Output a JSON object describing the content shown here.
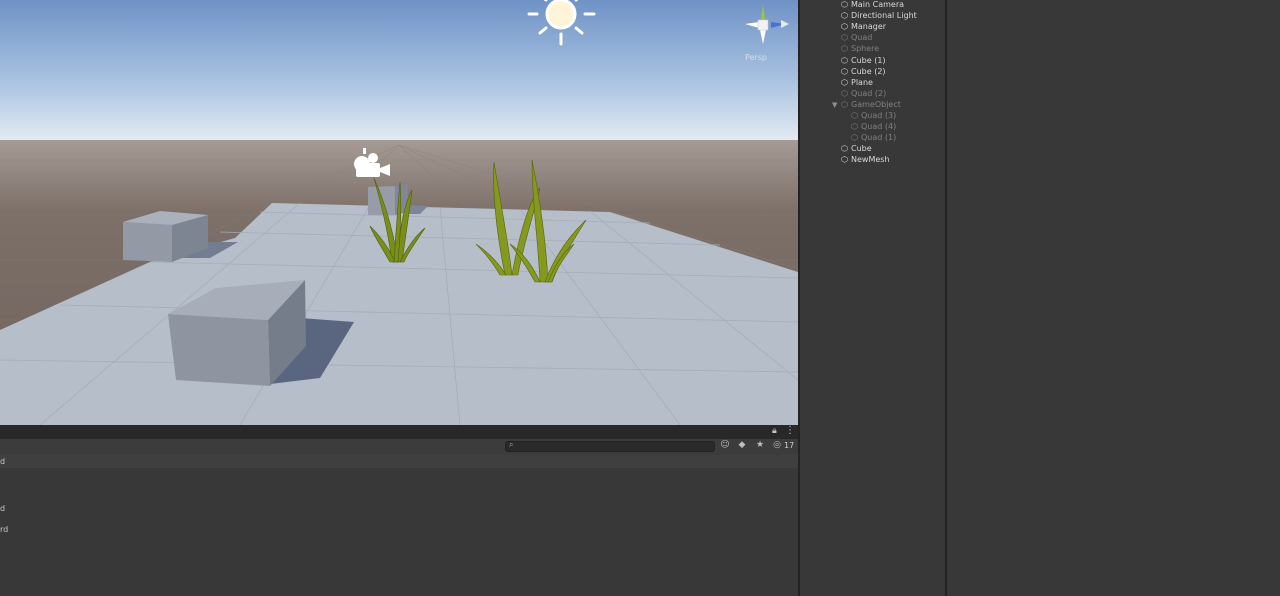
{
  "scene_view": {
    "gizmo_label": "Persp"
  },
  "console": {
    "search": {
      "placeholder": ""
    },
    "message_count": "17",
    "log_fragments": [
      "d",
      "d",
      "rd"
    ]
  },
  "hierarchy": {
    "items": [
      {
        "label": "Main Camera",
        "enabled": true,
        "indent": 0
      },
      {
        "label": "Directional Light",
        "enabled": true,
        "indent": 0
      },
      {
        "label": "Manager",
        "enabled": true,
        "indent": 0
      },
      {
        "label": "Quad",
        "enabled": false,
        "indent": 0
      },
      {
        "label": "Sphere",
        "enabled": false,
        "indent": 0
      },
      {
        "label": "Cube (1)",
        "enabled": true,
        "indent": 0
      },
      {
        "label": "Cube (2)",
        "enabled": true,
        "indent": 0
      },
      {
        "label": "Plane",
        "enabled": true,
        "indent": 0
      },
      {
        "label": "Quad (2)",
        "enabled": false,
        "indent": 0
      },
      {
        "label": "GameObject",
        "enabled": false,
        "indent": 0,
        "expanded": true
      },
      {
        "label": "Quad (3)",
        "enabled": false,
        "indent": 1
      },
      {
        "label": "Quad (4)",
        "enabled": false,
        "indent": 1
      },
      {
        "label": "Quad (1)",
        "enabled": false,
        "indent": 1
      },
      {
        "label": "Cube",
        "enabled": true,
        "indent": 0
      },
      {
        "label": "NewMesh",
        "enabled": true,
        "indent": 0
      }
    ]
  },
  "colors": {
    "sky_top": "#6f92c6",
    "horizon": "#e6eef5",
    "ground": "#7d7069",
    "plane": "#b6bec9",
    "panel_bg": "#383838",
    "grass": "#7a8f1a"
  }
}
